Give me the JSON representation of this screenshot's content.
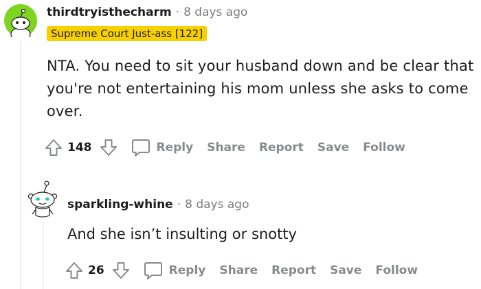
{
  "comment": {
    "author": "thirdtryisthecharm",
    "separator": "·",
    "time": "8 days ago",
    "flair": "Supreme Court Just-ass [122]",
    "body": "NTA. You need to sit your husband down and be clear that you're not entertaining his mom unless she asks to come over.",
    "votes": "148",
    "actions": {
      "reply": "Reply",
      "share": "Share",
      "report": "Report",
      "save": "Save",
      "follow": "Follow"
    },
    "colors": {
      "avatar_bg": "#7fd321",
      "flair_bg": "#f6d000"
    }
  },
  "reply": {
    "author": "sparkling-whine",
    "separator": "·",
    "time": "8 days ago",
    "body": "And she isn’t insulting or snotty",
    "votes": "26",
    "actions": {
      "reply": "Reply",
      "share": "Share",
      "report": "Report",
      "save": "Save",
      "follow": "Follow"
    },
    "colors": {
      "avatar_eye": "#2ec4c4"
    }
  },
  "icons": [
    "snoo-avatar-icon",
    "upvote-icon",
    "downvote-icon",
    "comment-bubble-icon"
  ]
}
